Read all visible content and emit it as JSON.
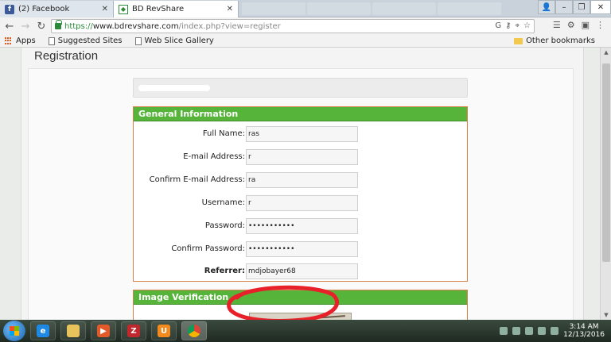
{
  "browser": {
    "tabs": [
      {
        "title": "(2) Facebook",
        "active": false
      },
      {
        "title": "BD RevShare",
        "active": true
      }
    ],
    "address": {
      "scheme": "https://",
      "host": "www.bdrevshare.com",
      "path": "/index.php?view=register"
    },
    "bookmarks": {
      "apps": "Apps",
      "suggested": "Suggested Sites",
      "webslice": "Web Slice Gallery",
      "other": "Other bookmarks"
    }
  },
  "page": {
    "title": "Registration",
    "general": {
      "heading": "General Information",
      "fields": [
        {
          "label": "Full Name:",
          "value": "ras"
        },
        {
          "label": "E-mail Address:",
          "value": "r"
        },
        {
          "label": "Confirm E-mail Address:",
          "value": "ra"
        },
        {
          "label": "Username:",
          "value": "r"
        },
        {
          "label": "Password:",
          "value": "•••••••••••"
        },
        {
          "label": "Confirm Password:",
          "value": "•••••••••••"
        },
        {
          "label": "Referrer:",
          "value": "mdjobayer68"
        }
      ]
    },
    "image_verification": {
      "heading": "Image Verification"
    }
  },
  "annotation": {
    "color": "#e8202a"
  },
  "taskbar": {
    "time": "3:14 AM",
    "date": "12/13/2016"
  },
  "colors": {
    "section_header": "#57b43a",
    "section_border": "#d9804a"
  }
}
